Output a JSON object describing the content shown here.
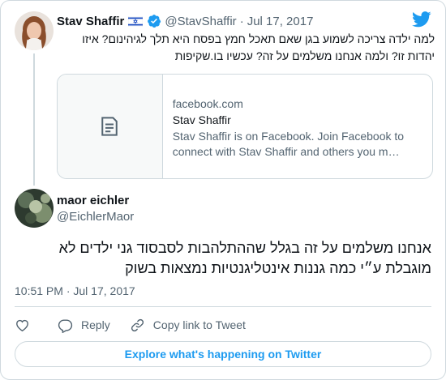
{
  "quoted_tweet": {
    "author_name": "Stav Shaffir",
    "flag_icon": "israel-flag-icon",
    "verified_icon": "verified-badge-icon",
    "handle": "@StavShaffir",
    "separator": "·",
    "date": "Jul 17, 2017",
    "text_line1": "למה ילדה צריכה לשמוע בגן שאם תאכל חמץ בפסח היא תלך לגיהינום? איזו",
    "text_line2": "יהדות זו? ולמה אנחנו משלמים על זה? עכשיו בו.שקיפות",
    "link_card": {
      "thumb_icon": "document-icon",
      "domain": "facebook.com",
      "title": "Stav Shaffir",
      "description": "Stav Shaffir is on Facebook. Join Facebook to connect with Stav Shaffir and others you m…"
    }
  },
  "reply_tweet": {
    "author_name": "maor eichler",
    "handle": "@EichlerMaor",
    "text_line1": "אנחנו משלמים על זה בגלל שההתלהבות לסבסוד גני ילדים לא",
    "text_line2": "מוגבלת ע״י כמה גננות אינטליגנטיות נמצאות בשוק",
    "time": "10:51 PM",
    "separator": "·",
    "date": "Jul 17, 2017"
  },
  "actions": {
    "like_icon": "heart-icon",
    "reply_icon": "reply-icon",
    "reply_label": "Reply",
    "copy_icon": "link-icon",
    "copy_label": "Copy link to Tweet"
  },
  "explore_label": "Explore what's happening on Twitter",
  "colors": {
    "brand_blue": "#1d9bf0",
    "text_primary": "#0f1419",
    "text_secondary": "#536471",
    "border": "#cfd9de"
  }
}
